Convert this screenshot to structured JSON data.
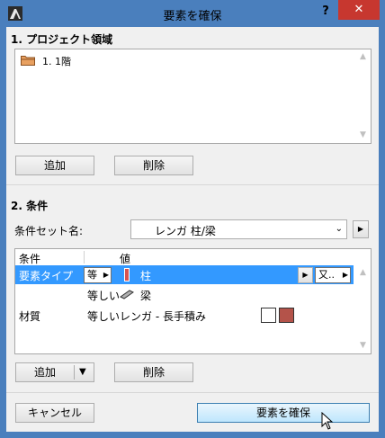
{
  "window": {
    "title": "要素を確保",
    "help_label": "?",
    "close_label": "✕"
  },
  "project_section": {
    "heading": "1. プロジェクト領域",
    "items": [
      {
        "icon": "folder-icon",
        "label": "1. 1階"
      }
    ],
    "add_button": "追加",
    "delete_button": "削除"
  },
  "criteria_section": {
    "heading": "2. 条件",
    "set_name_label": "条件セット名:",
    "set_name_value": "レンガ 柱/梁",
    "columns": {
      "condition": "条件",
      "value": "値"
    },
    "rows": [
      {
        "condition": "要素タイプ",
        "operator": "等",
        "value": "柱",
        "extra_button": "又..",
        "selected": true
      },
      {
        "condition": "",
        "operator": "等しい",
        "value": "梁",
        "selected": false
      },
      {
        "condition": "材質",
        "operator": "等しい",
        "value": "レンガ - 長手積み",
        "selected": false
      }
    ],
    "add_button": "追加",
    "delete_button": "削除"
  },
  "footer": {
    "cancel_button": "キャンセル",
    "confirm_button": "要素を確保"
  },
  "colors": {
    "selection": "#3399ff",
    "swatch_brick": "#b4534a",
    "close_red": "#c7372f"
  }
}
